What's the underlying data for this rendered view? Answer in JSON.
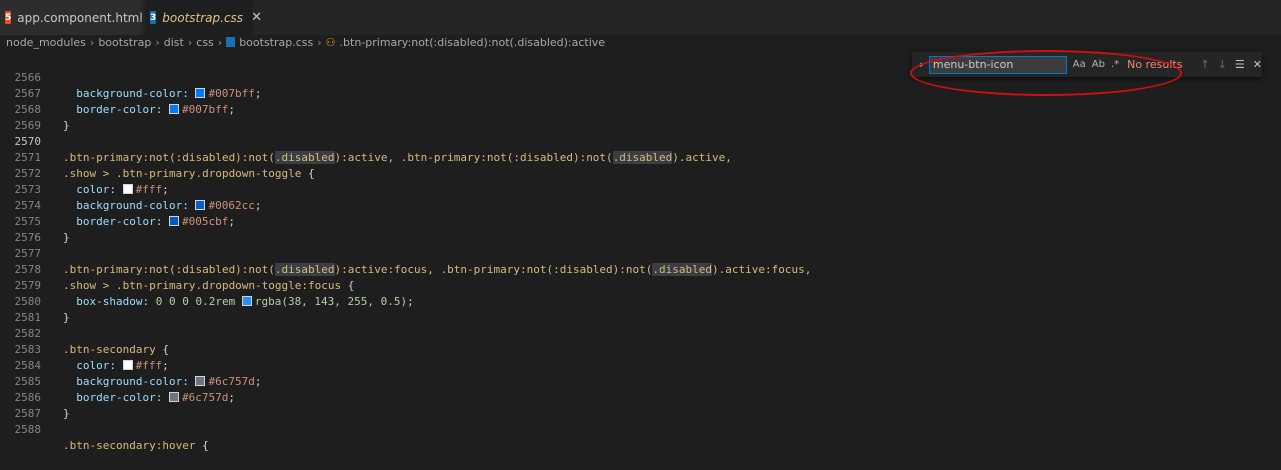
{
  "tabs": [
    {
      "label": "app.component.html",
      "icon": "html-file-icon",
      "modified": true
    },
    {
      "label": "bootstrap.css",
      "icon": "css-file-icon",
      "active": true
    }
  ],
  "breadcrumb": [
    "node_modules",
    "bootstrap",
    "dist",
    "css",
    "bootstrap.css",
    ".btn-primary:not(:disabled):not(.disabled):active"
  ],
  "find": {
    "value": "menu-btn-icon",
    "status": "No results",
    "opt_case": "Aa",
    "opt_word": "Ab",
    "opt_regex": ".*"
  },
  "lines": [
    {
      "n": "2566",
      "cur": false
    },
    {
      "n": "2567",
      "cur": false
    },
    {
      "n": "2568",
      "cur": false
    },
    {
      "n": "2569",
      "cur": false
    },
    {
      "n": "2570",
      "cur": true
    },
    {
      "n": "2571",
      "cur": false
    },
    {
      "n": "2572",
      "cur": false
    },
    {
      "n": "2573",
      "cur": false
    },
    {
      "n": "2574",
      "cur": false
    },
    {
      "n": "2575",
      "cur": false
    },
    {
      "n": "2576",
      "cur": false
    },
    {
      "n": "2577",
      "cur": false
    },
    {
      "n": "2578",
      "cur": false
    },
    {
      "n": "2579",
      "cur": false
    },
    {
      "n": "2580",
      "cur": false
    },
    {
      "n": "2581",
      "cur": false
    },
    {
      "n": "2582",
      "cur": false
    },
    {
      "n": "2583",
      "cur": false
    },
    {
      "n": "2584",
      "cur": false
    },
    {
      "n": "2585",
      "cur": false
    },
    {
      "n": "2586",
      "cur": false
    },
    {
      "n": "2587",
      "cur": false
    },
    {
      "n": "2588",
      "cur": false
    }
  ],
  "code": {
    "l2566": {
      "prop": "background-color: ",
      "val": "#007bff",
      "color": "#007bff"
    },
    "l2567": {
      "prop": "border-color: ",
      "val": "#007bff",
      "color": "#007bff"
    },
    "l2570": {
      "a": ".btn-primary:not(:disabled):not(",
      "b": ".disabled",
      "c": "):active, .btn-primary:not(:disabled):not(",
      "d": ".disabled",
      "e": ").active,"
    },
    "l2571": {
      "a": ".show > .btn-primary.dropdown-toggle",
      "b": " {"
    },
    "l2572": {
      "prop": "color: ",
      "val": "#fff",
      "color": "#ffffff"
    },
    "l2573": {
      "prop": "background-color: ",
      "val": "#0062cc",
      "color": "#0062cc"
    },
    "l2574": {
      "prop": "border-color: ",
      "val": "#005cbf",
      "color": "#005cbf"
    },
    "l2577": {
      "a": ".btn-primary:not(:disabled):not(",
      "b": ".disabled",
      "c": "):active:focus, .btn-primary:not(:disabled):not(",
      "d": ".disabled",
      "e": ").active:focus,"
    },
    "l2578": {
      "a": ".show > .btn-primary.dropdown-toggle:focus",
      "b": " {"
    },
    "l2579": {
      "prop": "box-shadow: ",
      "num": "0 0 0 0.2rem ",
      "val": "rgba(38, 143, 255, 0.5)",
      "color": "#268fff"
    },
    "l2582": {
      "a": ".btn-secondary",
      "b": " {"
    },
    "l2583": {
      "prop": "color: ",
      "val": "#fff",
      "color": "#ffffff"
    },
    "l2584": {
      "prop": "background-color: ",
      "val": "#6c757d",
      "color": "#6c757d"
    },
    "l2585": {
      "prop": "border-color: ",
      "val": "#6c757d",
      "color": "#6c757d"
    },
    "l2588": {
      "a": ".btn-secondary:hover",
      "b": " {"
    },
    "brace_close": "}",
    "semicolon": ";"
  }
}
